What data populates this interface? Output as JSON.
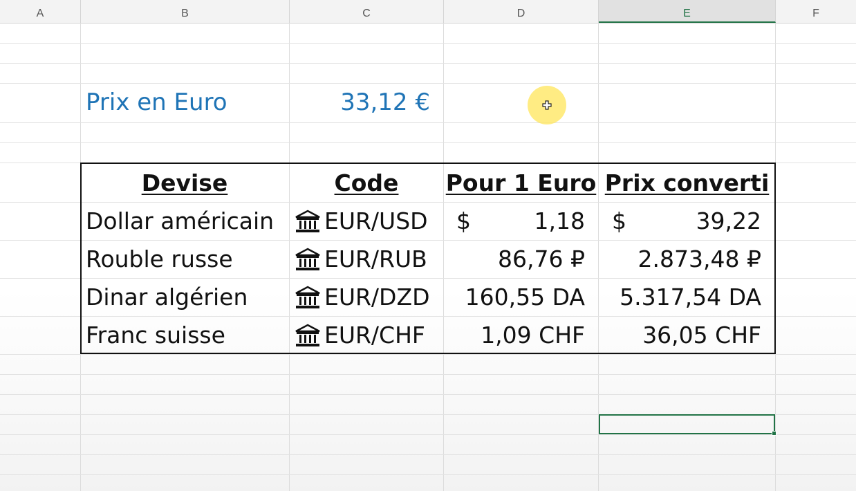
{
  "columns": [
    "A",
    "B",
    "C",
    "D",
    "E",
    "F"
  ],
  "selected_column": "E",
  "price": {
    "label": "Prix en Euro",
    "value": "33,12 €",
    "color": "#1f74b6"
  },
  "table": {
    "headers": [
      "Devise",
      "Code",
      "Pour 1 Euro",
      "Prix converti"
    ],
    "rows": [
      {
        "devise": "Dollar américain",
        "code_icon": "bank-icon",
        "code": "EUR/USD",
        "rate_prefix": "$",
        "rate": "1,18",
        "conv_prefix": "$",
        "converted": "39,22"
      },
      {
        "devise": "Rouble russe",
        "code_icon": "bank-icon",
        "code": "EUR/RUB",
        "rate_prefix": "",
        "rate": "86,76 ₽",
        "conv_prefix": "",
        "converted": "2.873,48 ₽"
      },
      {
        "devise": "Dinar algérien",
        "code_icon": "bank-icon",
        "code": "EUR/DZD",
        "rate_prefix": "",
        "rate": "160,55 DA",
        "conv_prefix": "",
        "converted": "5.317,54 DA"
      },
      {
        "devise": "Franc suisse",
        "code_icon": "bank-icon",
        "code": "EUR/CHF",
        "rate_prefix": "",
        "rate": "1,09 CHF",
        "conv_prefix": "",
        "converted": "36,05 CHF"
      }
    ]
  },
  "accent_color": "#217346"
}
